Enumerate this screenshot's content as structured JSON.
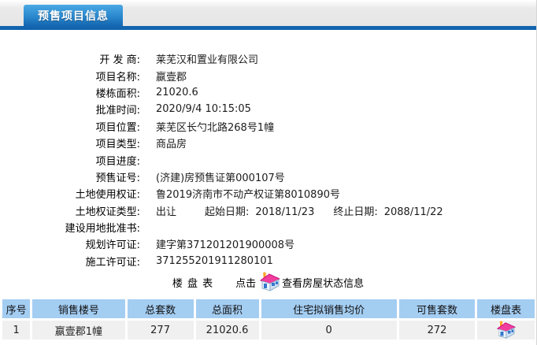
{
  "header": {
    "tab_label": "预售项目信息"
  },
  "colors": {
    "accent_blue": "#1264ae",
    "tab_gradient_top": "#4aa9e5",
    "table_header_bg": "#a4cdf2",
    "table_row_bg": "#f0f0f0"
  },
  "icons": {
    "house": "house-icon"
  },
  "form": {
    "developer": {
      "label": "开 发 商:",
      "value": "莱芜汉和置业有限公司"
    },
    "project_name": {
      "label": "项目名称:",
      "value": "嬴壹郡"
    },
    "building_area": {
      "label": "楼栋面积:",
      "value": "21020.6"
    },
    "approve_time": {
      "label": "批准时间:",
      "value": "2020/9/4 10:15:05"
    },
    "location": {
      "label": "项目位置:",
      "value": "莱芜区长勺北路268号1幢"
    },
    "project_type": {
      "label": "项目类型:",
      "value": "商品房"
    },
    "progress": {
      "label": "项目进度:",
      "value": ""
    },
    "presale_cert": {
      "label": "预售证号:",
      "value": "(济建)房预售证第000107号"
    },
    "land_use_cert": {
      "label": "土地使用权证:",
      "value": "鲁2019济南市不动产权证第8010890号"
    },
    "land_cert_type": {
      "label": "土地权证类型:",
      "value": "出让",
      "start_label": "起始日期:",
      "start_value": "2018/11/23",
      "end_label": "终止日期:",
      "end_value": "2088/11/22"
    },
    "land_approval": {
      "label": "建设用地批准书:",
      "value": ""
    },
    "planning_permit": {
      "label": "规划许可证:",
      "value": "建字第371201201900008号"
    },
    "construction_permit": {
      "label": "施工许可证:",
      "value": "371255201911280101"
    }
  },
  "loupan": {
    "title": "楼 盘 表",
    "click_label": "点击",
    "link_label": "查看房屋状态信息"
  },
  "table": {
    "headers": {
      "seq": "序号",
      "building": "销售楼号",
      "total_units": "总套数",
      "total_area": "总面积",
      "avg_price": "住宅拟销售均价",
      "sellable_units": "可售套数",
      "loupan": "楼盘表"
    },
    "rows": [
      {
        "seq": "1",
        "building": "嬴壹郡1幢",
        "total_units": "277",
        "total_area": "21020.6",
        "avg_price": "0",
        "sellable_units": "272"
      }
    ]
  }
}
